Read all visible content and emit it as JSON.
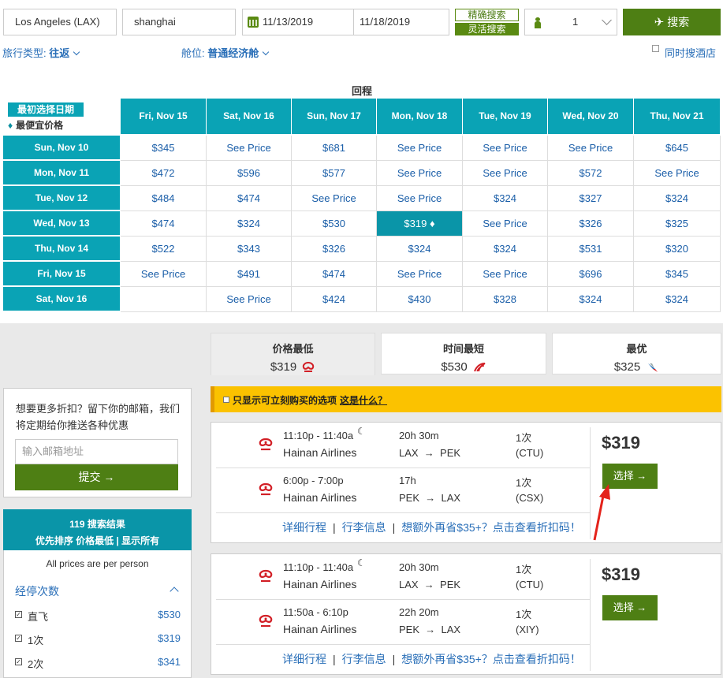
{
  "search": {
    "origin": "Los Angeles (LAX)",
    "destination": "shanghai",
    "depart_date": "11/13/2019",
    "return_date": "11/18/2019",
    "mode_exact": "精确搜索",
    "mode_flexible": "灵活搜索",
    "passengers": "1",
    "search_label": "搜索",
    "trip_type_label": "旅行类型:",
    "trip_type_value": "往返",
    "cabin_label": "舱位:",
    "cabin_value": "普通经济舱",
    "hotel_label": "同时搜酒店"
  },
  "matrix": {
    "return_title": "回程",
    "legend_first_date": "最初选择日期",
    "legend_lowest": "最便宜价格",
    "return_dates": [
      "Fri, Nov 15",
      "Sat, Nov 16",
      "Sun, Nov 17",
      "Mon, Nov 18",
      "Tue, Nov 19",
      "Wed, Nov 20",
      "Thu, Nov 21"
    ],
    "depart_dates": [
      "Sun, Nov 10",
      "Mon, Nov 11",
      "Tue, Nov 12",
      "Wed, Nov 13",
      "Thu, Nov 14",
      "Fri, Nov 15",
      "Sat, Nov 16"
    ],
    "rows": [
      [
        "$345",
        "See Price",
        "$681",
        "See Price",
        "See Price",
        "See Price",
        "$645"
      ],
      [
        "$472",
        "$596",
        "$577",
        "See Price",
        "See Price",
        "$572",
        "See Price"
      ],
      [
        "$484",
        "$474",
        "See Price",
        "See Price",
        "$324",
        "$327",
        "$324"
      ],
      [
        "$474",
        "$324",
        "$530",
        "$319 ♦",
        "See Price",
        "$326",
        "$325"
      ],
      [
        "$522",
        "$343",
        "$326",
        "$324",
        "$324",
        "$531",
        "$320"
      ],
      [
        "See Price",
        "$491",
        "$474",
        "See Price",
        "See Price",
        "$696",
        "$345"
      ],
      [
        "",
        "See Price",
        "$424",
        "$430",
        "$328",
        "$324",
        "$324"
      ]
    ]
  },
  "sort_tabs": [
    {
      "title": "价格最低",
      "price": "$319"
    },
    {
      "title": "时间最短",
      "price": "$530"
    },
    {
      "title": "最优",
      "price": "$325"
    }
  ],
  "promo": {
    "text": "想要更多折扣？留下你的邮箱，我们将定期给你推送各种优惠",
    "email_placeholder": "输入邮箱地址",
    "submit_label": "提交 →"
  },
  "results": {
    "count_line": "119 搜索结果",
    "sort_line": "优先排序 价格最低 | 显示所有",
    "per_person": "All prices are per person",
    "stops_title": "经停次数",
    "stop_filters": [
      {
        "label": "直飞",
        "price": "$530"
      },
      {
        "label": "1次",
        "price": "$319"
      },
      {
        "label": "2次",
        "price": "$341"
      }
    ]
  },
  "banner": {
    "text": "只显示可立刻购买的选项",
    "link": "这是什么？"
  },
  "flights": [
    {
      "price": "$319",
      "choose_label": "选择 →",
      "segments": [
        {
          "time": "11:10p - 11:40a",
          "airline": "Hainan Airlines",
          "duration": "20h 30m",
          "route": "LAX  →  PEK",
          "stops": "1次",
          "via": "(CTU)",
          "overnight": true
        },
        {
          "time": "6:00p - 7:00p",
          "airline": "Hainan Airlines",
          "duration": "17h",
          "route": "PEK  →  LAX",
          "stops": "1次",
          "via": "(CSX)",
          "overnight": false
        }
      ],
      "link_details": "详细行程",
      "link_baggage": "行李信息",
      "link_promo": "想额外再省$35+？点击查看折扣码！"
    },
    {
      "price": "$319",
      "choose_label": "选择 →",
      "segments": [
        {
          "time": "11:10p - 11:40a",
          "airline": "Hainan Airlines",
          "duration": "20h 30m",
          "route": "LAX  →  PEK",
          "stops": "1次",
          "via": "(CTU)",
          "overnight": true
        },
        {
          "time": "11:50a - 6:10p",
          "airline": "Hainan Airlines",
          "duration": "22h 20m",
          "route": "PEK  →  LAX",
          "stops": "1次",
          "via": "(XIY)",
          "overnight": false
        }
      ],
      "link_details": "详细行程",
      "link_baggage": "行李信息",
      "link_promo": "想额外再省$35+？点击查看折扣码！"
    }
  ],
  "icons": {
    "calendar": "calendar-icon",
    "passenger": "person-icon",
    "plane": "plane-icon",
    "hainan_logo": "hainan-airlines-logo",
    "airchina_logo": "air-china-logo",
    "american_logo": "american-airlines-logo",
    "moon": "moon-icon",
    "lowest_marker": "diamond-icon"
  },
  "colors": {
    "accent_green": "#4e7f14",
    "matrix_teal": "#0aa3b5",
    "link_blue": "#2a6fb8",
    "banner_yellow": "#fbc200"
  }
}
